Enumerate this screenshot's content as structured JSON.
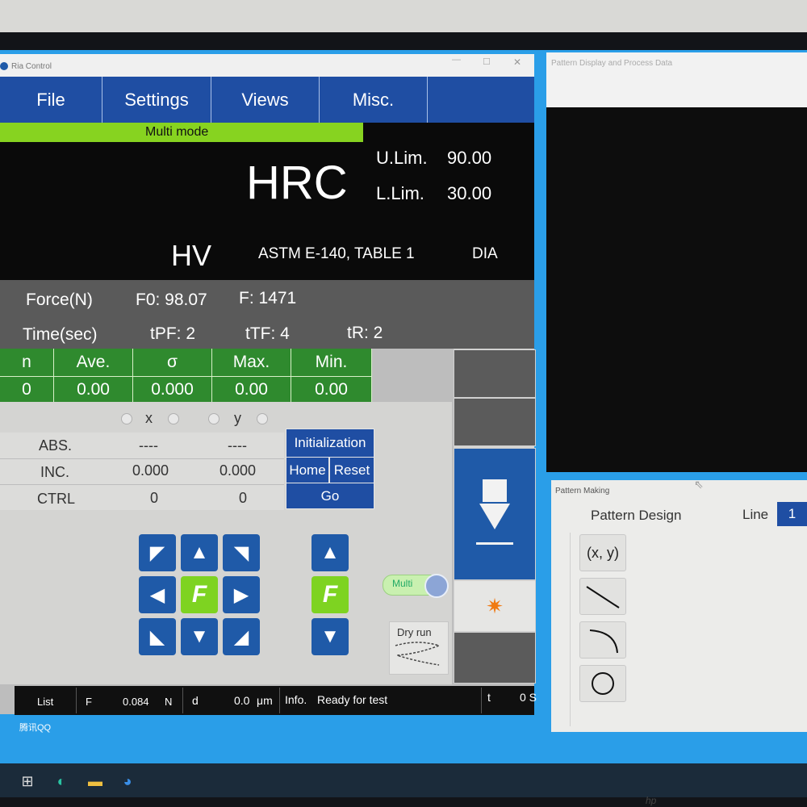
{
  "window": {
    "title": "Ria Control"
  },
  "menu": {
    "items": [
      "File",
      "Settings",
      "Views",
      "Misc."
    ]
  },
  "mode": "Multi mode",
  "scale": {
    "main": "HRC",
    "upper_label": "U.Lim.",
    "upper_value": "90.00",
    "lower_label": "L.Lim.",
    "lower_value": "30.00",
    "secondary": "HV",
    "standard": "ASTM E-140, TABLE 1",
    "method": "DIA"
  },
  "params": {
    "force_label": "Force(N)",
    "f0": "F0: 98.07",
    "f": "F: 1471",
    "time_label": "Time(sec)",
    "tpf": "tPF: 2",
    "ttf": "tTF: 4",
    "tr": "tR: 2"
  },
  "stats": {
    "headers": [
      "n",
      "Ave.",
      "σ",
      "Max.",
      "Min."
    ],
    "values": [
      "0",
      "0.00",
      "0.000",
      "0.00",
      "0.00"
    ]
  },
  "position": {
    "axis_x": "x",
    "axis_y": "y",
    "rows": [
      {
        "label": "ABS.",
        "x": "----",
        "y": "----"
      },
      {
        "label": "INC.",
        "x": "0.000",
        "y": "0.000"
      },
      {
        "label": "CTRL",
        "x": "0",
        "y": "0"
      }
    ]
  },
  "buttons": {
    "initialization": "Initialization",
    "home": "Home",
    "reset": "Reset",
    "go": "Go"
  },
  "jog": {
    "fast": "F"
  },
  "toggle": {
    "label": "Multi"
  },
  "dry_run": "Dry run",
  "status": {
    "list": "List",
    "f_label": "F",
    "f_value": "0.084",
    "f_unit": "N",
    "d_label": "d",
    "d_value": "0.0",
    "d_unit": "μm",
    "info_label": "Info.",
    "info_text": "Ready for test",
    "t_label": "t",
    "t_value": "0 S"
  },
  "desktop_label": "腾讯QQ",
  "pattern_display": {
    "title": "Pattern Display and Process Data"
  },
  "pattern_making": {
    "title": "Pattern Making",
    "design": "Pattern Design",
    "line_label": "Line",
    "line_value": "1",
    "point_tool": "(x, y)"
  },
  "colors": {
    "menu_blue": "#1f4ea3",
    "stat_green": "#2f8a2e",
    "mode_green": "#87d320",
    "jog_blue": "#1f5aa8"
  }
}
